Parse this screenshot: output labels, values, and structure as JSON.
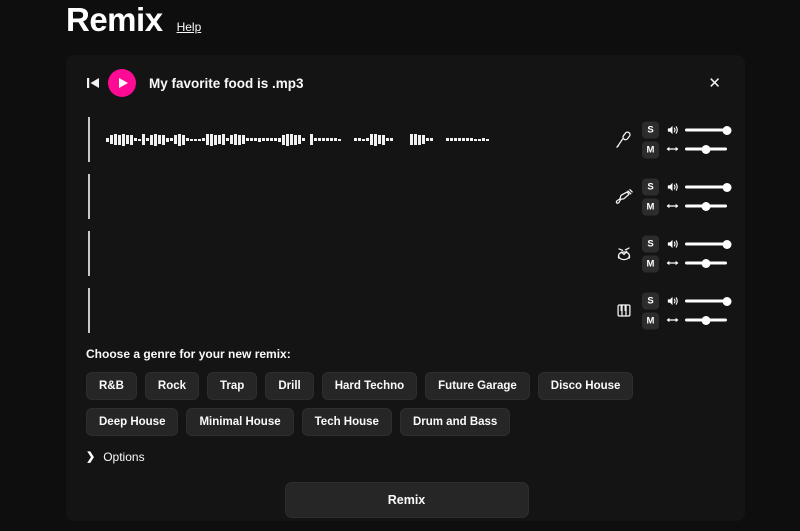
{
  "header": {
    "title": "Remix",
    "help_label": "Help"
  },
  "player": {
    "skip_back_icon": "skip-back-icon",
    "play_icon": "play-icon",
    "file_name": "My favorite food is .mp3",
    "close_icon": "✕"
  },
  "colors": {
    "page_bg": "#0e0e0e",
    "panel_bg": "#141414",
    "accent_pink": "#ff0a94",
    "button_bg": "#262626",
    "text": "#fafafa",
    "waveform": "#f0f0f0"
  },
  "tracks": [
    {
      "instrument": "vocals",
      "instrument_icon": "microphone-icon",
      "solo_label": "S",
      "mute_label": "M",
      "volume_icon": "volume-icon",
      "pan_icon": "pan-icon",
      "volume": 100,
      "pan": 50,
      "waveform": [
        4,
        9,
        11,
        10,
        12,
        9,
        10,
        3,
        2,
        11,
        3,
        10,
        12,
        9,
        10,
        4,
        3,
        9,
        12,
        10,
        3,
        2,
        2,
        2,
        3,
        11,
        12,
        10,
        9,
        11,
        3,
        9,
        11,
        10,
        9,
        3,
        3,
        3,
        4,
        3,
        3,
        3,
        3,
        4,
        10,
        12,
        11,
        10,
        9,
        3,
        0,
        11,
        3,
        3,
        3,
        3,
        3,
        3,
        2,
        0,
        0,
        0,
        3,
        3,
        2,
        3,
        11,
        12,
        9,
        10,
        3,
        3,
        0,
        0,
        0,
        0,
        11,
        11,
        10,
        9,
        3,
        3,
        0,
        0,
        0,
        3,
        3,
        3,
        3,
        3,
        3,
        3,
        2,
        2,
        3,
        2
      ]
    },
    {
      "instrument": "guitar",
      "instrument_icon": "guitar-icon",
      "solo_label": "S",
      "mute_label": "M",
      "volume_icon": "volume-icon",
      "pan_icon": "pan-icon",
      "volume": 100,
      "pan": 50,
      "waveform": []
    },
    {
      "instrument": "drums",
      "instrument_icon": "drums-icon",
      "solo_label": "S",
      "mute_label": "M",
      "volume_icon": "volume-icon",
      "pan_icon": "pan-icon",
      "volume": 100,
      "pan": 50,
      "waveform": []
    },
    {
      "instrument": "keys",
      "instrument_icon": "piano-icon",
      "solo_label": "S",
      "mute_label": "M",
      "volume_icon": "volume-icon",
      "pan_icon": "pan-icon",
      "volume": 100,
      "pan": 50,
      "waveform": []
    }
  ],
  "genre": {
    "label": "Choose a genre for your new remix:",
    "options": [
      "R&B",
      "Rock",
      "Trap",
      "Drill",
      "Hard Techno",
      "Future Garage",
      "Disco House",
      "Deep House",
      "Minimal House",
      "Tech House",
      "Drum and Bass"
    ]
  },
  "options": {
    "chevron": "❯",
    "label": "Options"
  },
  "actions": {
    "remix_label": "Remix"
  }
}
